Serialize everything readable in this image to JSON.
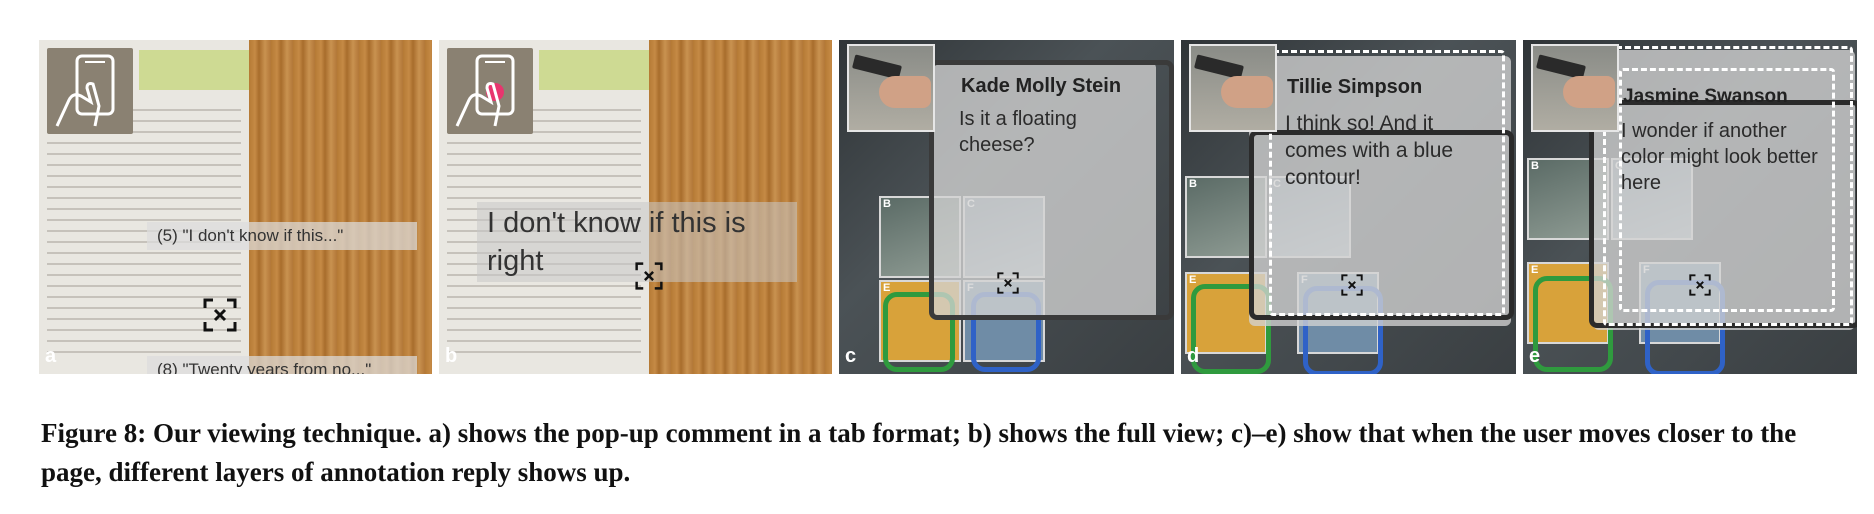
{
  "panels": {
    "a": {
      "letter": "a",
      "tab_comment": "(5)  \"I don't know if this...\"",
      "next_comment": "(8)  \"Twenty years from no...\""
    },
    "b": {
      "letter": "b",
      "full_comment": "I don't know if this is right"
    },
    "c": {
      "letter": "c",
      "name": "Kade Molly Stein",
      "text": "Is it a floating cheese?"
    },
    "d": {
      "letter": "d",
      "name": "Tillie Simpson",
      "text": "I think so! And it comes with a blue contour!"
    },
    "e": {
      "letter": "e",
      "name": "Jasmine Swanson",
      "text": "I wonder if another color might look better here"
    }
  },
  "thumb_labels": {
    "b": "B",
    "c": "C",
    "e": "E",
    "f": "F"
  },
  "colors": {
    "highlight_green": "#c4d678",
    "contour_green": "#2f9a3e",
    "contour_blue": "#2f62c7",
    "touch_pink": "#e8356e"
  },
  "caption": "Figure 8: Our viewing technique. a) shows the pop-up comment in a tab format; b) shows the full view; c)–e) show that when the user moves closer to the page, different layers of annotation reply shows up."
}
